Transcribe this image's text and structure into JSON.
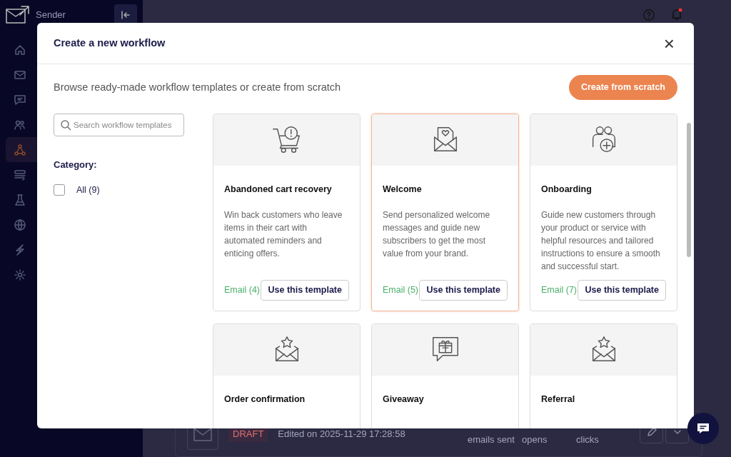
{
  "app": {
    "logo": "Sender",
    "sidebar": [
      {
        "kind": "home",
        "selected": false
      },
      {
        "kind": "mail",
        "selected": false
      },
      {
        "kind": "chat",
        "selected": false
      },
      {
        "kind": "people",
        "selected": false
      },
      {
        "kind": "workflow",
        "selected": true
      },
      {
        "kind": "form",
        "selected": false
      },
      {
        "kind": "flask",
        "selected": false
      },
      {
        "kind": "globe",
        "selected": false
      },
      {
        "kind": "bolt",
        "selected": false
      },
      {
        "kind": "gear",
        "selected": false
      }
    ],
    "row": {
      "status": "DRAFT",
      "edited": "Edited on 2025-11-29 17:28:58",
      "stats": [
        "emails sent",
        "opens",
        "clicks"
      ]
    }
  },
  "modal": {
    "title": "Create a new workflow",
    "close": "×",
    "subtitle": "Browse ready-made workflow templates or create from scratch",
    "create_button": "Create from scratch",
    "search": {
      "placeholder": "Search workflow templates"
    },
    "category_label": "Category:",
    "categories": [
      {
        "label": "All (9)",
        "checked": false
      }
    ],
    "templates": [
      {
        "kind": "cart",
        "title": "Abandoned cart recovery",
        "description": "Win back customers who leave items in their cart with automated reminders and enticing offers.",
        "channel": "Email (4)",
        "button": "Use this template",
        "selected": false
      },
      {
        "kind": "letter",
        "title": "Welcome",
        "description": "Send personalized welcome messages and guide new subscribers to get the most value from your brand.",
        "channel": "Email (5)",
        "button": "Use this template",
        "selected": true
      },
      {
        "kind": "people",
        "title": "Onboarding",
        "description": "Guide new customers through your product or service with helpful resources and tailored instructions to ensure a smooth and successful start.",
        "channel": "Email (7)",
        "button": "Use this template",
        "selected": false
      },
      {
        "kind": "star",
        "title": "Order confirmation",
        "selected": false
      },
      {
        "kind": "gift",
        "title": "Giveaway",
        "selected": false
      },
      {
        "kind": "star",
        "title": "Referral",
        "selected": false
      }
    ]
  }
}
